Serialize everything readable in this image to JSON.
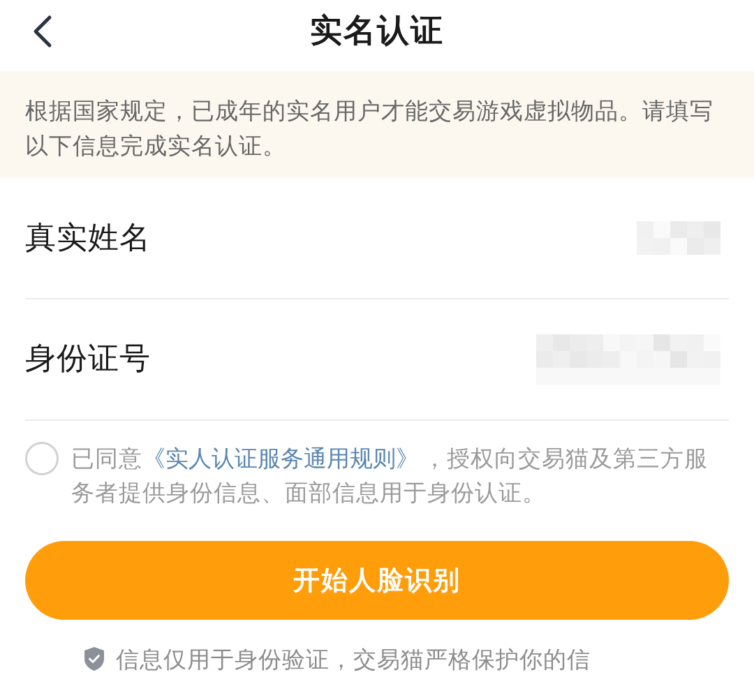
{
  "header": {
    "title": "实名认证"
  },
  "notice": {
    "text": "根据国家规定，已成年的实名用户才能交易游戏虚拟物品。请填写以下信息完成实名认证。"
  },
  "fields": [
    {
      "label": "真实姓名",
      "value_obscured": true
    },
    {
      "label": "身份证号",
      "value_obscured": true
    }
  ],
  "agreement": {
    "checked": false,
    "text_before": "已同意",
    "link": "《实人认证服务通用规则》",
    "text_after": "，授权向交易猫及第三方服务者提供身份信息、面部信息用于身份认证。"
  },
  "primary_button": {
    "label": "开始人脸识别"
  },
  "footer_note": {
    "text": "信息仅用于身份验证，交易猫严格保护你的信"
  }
}
